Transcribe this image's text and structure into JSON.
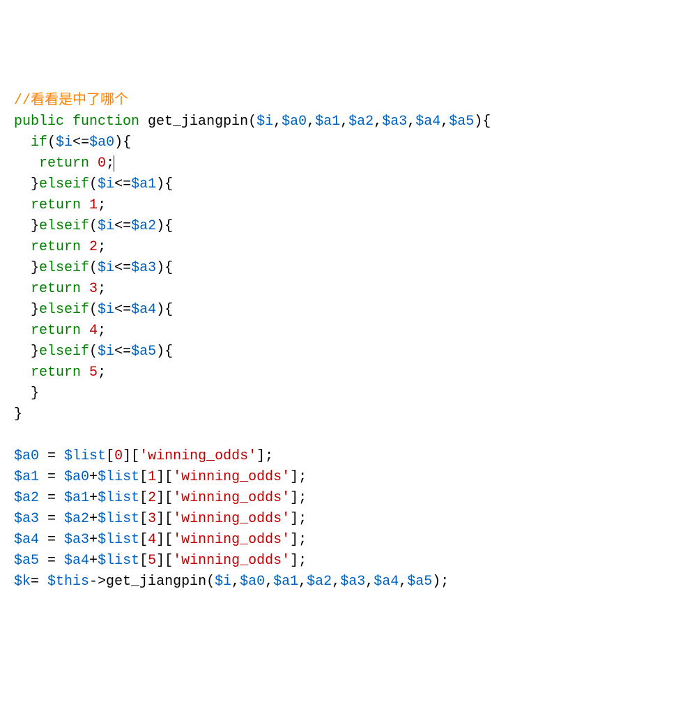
{
  "tokens": [
    {
      "cls": "comment",
      "t": "//看看是中了哪个"
    },
    {
      "br": 1
    },
    {
      "cls": "kw",
      "t": "public"
    },
    {
      "cls": "txt",
      "t": " "
    },
    {
      "cls": "kw",
      "t": "function"
    },
    {
      "cls": "txt",
      "t": " get_jiangpin("
    },
    {
      "cls": "var",
      "t": "$i"
    },
    {
      "cls": "txt",
      "t": ","
    },
    {
      "cls": "var",
      "t": "$a0"
    },
    {
      "cls": "txt",
      "t": ","
    },
    {
      "cls": "var",
      "t": "$a1"
    },
    {
      "cls": "txt",
      "t": ","
    },
    {
      "cls": "var",
      "t": "$a2"
    },
    {
      "cls": "txt",
      "t": ","
    },
    {
      "cls": "var",
      "t": "$a3"
    },
    {
      "cls": "txt",
      "t": ","
    },
    {
      "cls": "var",
      "t": "$a4"
    },
    {
      "cls": "txt",
      "t": ","
    },
    {
      "cls": "var",
      "t": "$a5"
    },
    {
      "cls": "txt",
      "t": "){"
    },
    {
      "br": 1
    },
    {
      "cls": "txt",
      "t": "  "
    },
    {
      "cls": "kw",
      "t": "if"
    },
    {
      "cls": "txt",
      "t": "("
    },
    {
      "cls": "var",
      "t": "$i"
    },
    {
      "cls": "txt",
      "t": "<="
    },
    {
      "cls": "var",
      "t": "$a0"
    },
    {
      "cls": "txt",
      "t": "){"
    },
    {
      "br": 1
    },
    {
      "cls": "txt",
      "t": "   "
    },
    {
      "cls": "kw",
      "t": "return"
    },
    {
      "cls": "txt",
      "t": " "
    },
    {
      "cls": "num",
      "t": "0"
    },
    {
      "cls": "txt",
      "t": ";"
    },
    {
      "cursor": 1
    },
    {
      "br": 1
    },
    {
      "cls": "txt",
      "t": "  }"
    },
    {
      "cls": "kw",
      "t": "elseif"
    },
    {
      "cls": "txt",
      "t": "("
    },
    {
      "cls": "var",
      "t": "$i"
    },
    {
      "cls": "txt",
      "t": "<="
    },
    {
      "cls": "var",
      "t": "$a1"
    },
    {
      "cls": "txt",
      "t": "){"
    },
    {
      "br": 1
    },
    {
      "cls": "txt",
      "t": "  "
    },
    {
      "cls": "kw",
      "t": "return"
    },
    {
      "cls": "txt",
      "t": " "
    },
    {
      "cls": "num",
      "t": "1"
    },
    {
      "cls": "txt",
      "t": ";"
    },
    {
      "br": 1
    },
    {
      "cls": "txt",
      "t": "  }"
    },
    {
      "cls": "kw",
      "t": "elseif"
    },
    {
      "cls": "txt",
      "t": "("
    },
    {
      "cls": "var",
      "t": "$i"
    },
    {
      "cls": "txt",
      "t": "<="
    },
    {
      "cls": "var",
      "t": "$a2"
    },
    {
      "cls": "txt",
      "t": "){"
    },
    {
      "br": 1
    },
    {
      "cls": "txt",
      "t": "  "
    },
    {
      "cls": "kw",
      "t": "return"
    },
    {
      "cls": "txt",
      "t": " "
    },
    {
      "cls": "num",
      "t": "2"
    },
    {
      "cls": "txt",
      "t": ";"
    },
    {
      "br": 1
    },
    {
      "cls": "txt",
      "t": "  }"
    },
    {
      "cls": "kw",
      "t": "elseif"
    },
    {
      "cls": "txt",
      "t": "("
    },
    {
      "cls": "var",
      "t": "$i"
    },
    {
      "cls": "txt",
      "t": "<="
    },
    {
      "cls": "var",
      "t": "$a3"
    },
    {
      "cls": "txt",
      "t": "){"
    },
    {
      "br": 1
    },
    {
      "cls": "txt",
      "t": "  "
    },
    {
      "cls": "kw",
      "t": "return"
    },
    {
      "cls": "txt",
      "t": " "
    },
    {
      "cls": "num",
      "t": "3"
    },
    {
      "cls": "txt",
      "t": ";"
    },
    {
      "br": 1
    },
    {
      "cls": "txt",
      "t": "  }"
    },
    {
      "cls": "kw",
      "t": "elseif"
    },
    {
      "cls": "txt",
      "t": "("
    },
    {
      "cls": "var",
      "t": "$i"
    },
    {
      "cls": "txt",
      "t": "<="
    },
    {
      "cls": "var",
      "t": "$a4"
    },
    {
      "cls": "txt",
      "t": "){"
    },
    {
      "br": 1
    },
    {
      "cls": "txt",
      "t": "  "
    },
    {
      "cls": "kw",
      "t": "return"
    },
    {
      "cls": "txt",
      "t": " "
    },
    {
      "cls": "num",
      "t": "4"
    },
    {
      "cls": "txt",
      "t": ";"
    },
    {
      "br": 1
    },
    {
      "cls": "txt",
      "t": "  }"
    },
    {
      "cls": "kw",
      "t": "elseif"
    },
    {
      "cls": "txt",
      "t": "("
    },
    {
      "cls": "var",
      "t": "$i"
    },
    {
      "cls": "txt",
      "t": "<="
    },
    {
      "cls": "var",
      "t": "$a5"
    },
    {
      "cls": "txt",
      "t": "){"
    },
    {
      "br": 1
    },
    {
      "cls": "txt",
      "t": "  "
    },
    {
      "cls": "kw",
      "t": "return"
    },
    {
      "cls": "txt",
      "t": " "
    },
    {
      "cls": "num",
      "t": "5"
    },
    {
      "cls": "txt",
      "t": ";"
    },
    {
      "br": 1
    },
    {
      "cls": "txt",
      "t": "  }"
    },
    {
      "br": 1
    },
    {
      "cls": "txt",
      "t": "}"
    },
    {
      "br": 1
    },
    {
      "br": 1
    },
    {
      "cls": "var",
      "t": "$a0"
    },
    {
      "cls": "txt",
      "t": " = "
    },
    {
      "cls": "var",
      "t": "$list"
    },
    {
      "cls": "txt",
      "t": "["
    },
    {
      "cls": "num",
      "t": "0"
    },
    {
      "cls": "txt",
      "t": "]["
    },
    {
      "cls": "str",
      "t": "'winning_odds'"
    },
    {
      "cls": "txt",
      "t": "];"
    },
    {
      "br": 1
    },
    {
      "cls": "var",
      "t": "$a1"
    },
    {
      "cls": "txt",
      "t": " = "
    },
    {
      "cls": "var",
      "t": "$a0"
    },
    {
      "cls": "txt",
      "t": "+"
    },
    {
      "cls": "var",
      "t": "$list"
    },
    {
      "cls": "txt",
      "t": "["
    },
    {
      "cls": "num",
      "t": "1"
    },
    {
      "cls": "txt",
      "t": "]["
    },
    {
      "cls": "str",
      "t": "'winning_odds'"
    },
    {
      "cls": "txt",
      "t": "];"
    },
    {
      "br": 1
    },
    {
      "cls": "var",
      "t": "$a2"
    },
    {
      "cls": "txt",
      "t": " = "
    },
    {
      "cls": "var",
      "t": "$a1"
    },
    {
      "cls": "txt",
      "t": "+"
    },
    {
      "cls": "var",
      "t": "$list"
    },
    {
      "cls": "txt",
      "t": "["
    },
    {
      "cls": "num",
      "t": "2"
    },
    {
      "cls": "txt",
      "t": "]["
    },
    {
      "cls": "str",
      "t": "'winning_odds'"
    },
    {
      "cls": "txt",
      "t": "];"
    },
    {
      "br": 1
    },
    {
      "cls": "var",
      "t": "$a3"
    },
    {
      "cls": "txt",
      "t": " = "
    },
    {
      "cls": "var",
      "t": "$a2"
    },
    {
      "cls": "txt",
      "t": "+"
    },
    {
      "cls": "var",
      "t": "$list"
    },
    {
      "cls": "txt",
      "t": "["
    },
    {
      "cls": "num",
      "t": "3"
    },
    {
      "cls": "txt",
      "t": "]["
    },
    {
      "cls": "str",
      "t": "'winning_odds'"
    },
    {
      "cls": "txt",
      "t": "];"
    },
    {
      "br": 1
    },
    {
      "cls": "var",
      "t": "$a4"
    },
    {
      "cls": "txt",
      "t": " = "
    },
    {
      "cls": "var",
      "t": "$a3"
    },
    {
      "cls": "txt",
      "t": "+"
    },
    {
      "cls": "var",
      "t": "$list"
    },
    {
      "cls": "txt",
      "t": "["
    },
    {
      "cls": "num",
      "t": "4"
    },
    {
      "cls": "txt",
      "t": "]["
    },
    {
      "cls": "str",
      "t": "'winning_odds'"
    },
    {
      "cls": "txt",
      "t": "];"
    },
    {
      "br": 1
    },
    {
      "cls": "var",
      "t": "$a5"
    },
    {
      "cls": "txt",
      "t": " = "
    },
    {
      "cls": "var",
      "t": "$a4"
    },
    {
      "cls": "txt",
      "t": "+"
    },
    {
      "cls": "var",
      "t": "$list"
    },
    {
      "cls": "txt",
      "t": "["
    },
    {
      "cls": "num",
      "t": "5"
    },
    {
      "cls": "txt",
      "t": "]["
    },
    {
      "cls": "str",
      "t": "'winning_odds'"
    },
    {
      "cls": "txt",
      "t": "];"
    },
    {
      "br": 1
    },
    {
      "cls": "var",
      "t": "$k"
    },
    {
      "cls": "txt",
      "t": "= "
    },
    {
      "cls": "var",
      "t": "$this"
    },
    {
      "cls": "txt",
      "t": "->get_jiangpin("
    },
    {
      "cls": "var",
      "t": "$i"
    },
    {
      "cls": "txt",
      "t": ","
    },
    {
      "cls": "var",
      "t": "$a0"
    },
    {
      "cls": "txt",
      "t": ","
    },
    {
      "cls": "var",
      "t": "$a1"
    },
    {
      "cls": "txt",
      "t": ","
    },
    {
      "cls": "var",
      "t": "$a2"
    },
    {
      "cls": "txt",
      "t": ","
    },
    {
      "cls": "var",
      "t": "$a3"
    },
    {
      "cls": "txt",
      "t": ","
    },
    {
      "cls": "var",
      "t": "$a4"
    },
    {
      "cls": "txt",
      "t": ","
    },
    {
      "cls": "var",
      "t": "$a5"
    },
    {
      "cls": "txt",
      "t": ");"
    }
  ]
}
